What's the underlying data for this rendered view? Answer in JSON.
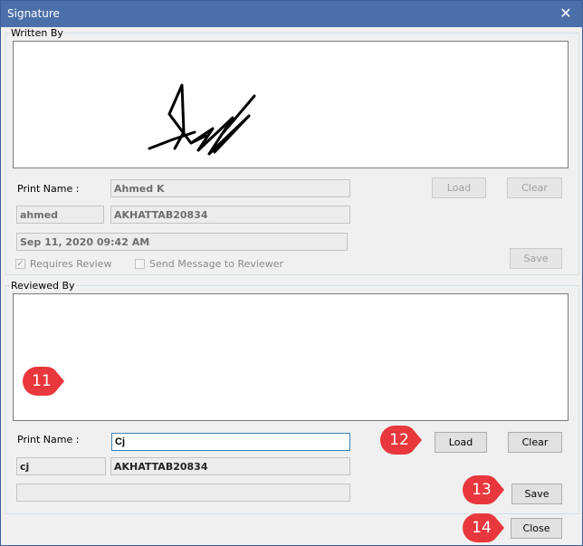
{
  "window": {
    "title": "Signature",
    "close_glyph": "✕"
  },
  "written": {
    "legend": "Written By",
    "print_name_label": "Print Name :",
    "print_name": "Ahmed K",
    "user_id": "ahmed",
    "user_code": "AKHATTAB20834",
    "timestamp": "Sep 11, 2020 09:42 AM",
    "requires_review_label": "Requires Review",
    "requires_review_checked": true,
    "send_message_label": "Send Message to Reviewer",
    "send_message_checked": false,
    "load_label": "Load",
    "clear_label": "Clear",
    "save_label": "Save"
  },
  "reviewed": {
    "legend": "Reviewed By",
    "print_name_label": "Print Name :",
    "print_name": "Cj",
    "user_id": "cj",
    "user_code": "AKHATTAB20834",
    "timestamp": "",
    "load_label": "Load",
    "clear_label": "Clear",
    "save_label": "Save"
  },
  "close_label": "Close",
  "markers": {
    "m11": "11",
    "m12": "12",
    "m13": "13",
    "m14": "14",
    "color": "#e8383d"
  },
  "icons": {
    "close": "close-icon",
    "check": "checkmark-icon",
    "marker": "callout-marker-icon"
  }
}
